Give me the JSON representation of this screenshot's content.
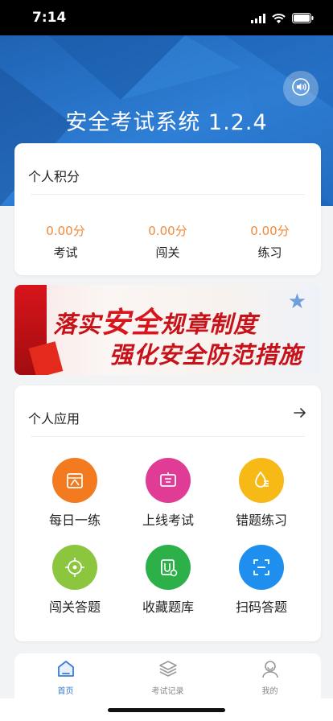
{
  "status": {
    "time": "7:14"
  },
  "header": {
    "title": "安全考试系统 1.2.4",
    "sound_icon": "speaker-icon"
  },
  "points": {
    "title": "个人积分",
    "items": [
      {
        "value": "0.00分",
        "label": "考试"
      },
      {
        "value": "0.00分",
        "label": "闯关"
      },
      {
        "value": "0.00分",
        "label": "练习"
      }
    ]
  },
  "banner": {
    "line1_a": "落实",
    "line1_b": "安全",
    "line1_c": "规章制度",
    "line2": "强化安全防范措施"
  },
  "apps": {
    "title": "个人应用",
    "items": [
      {
        "label": "每日一练",
        "icon": "calendar-icon",
        "color": "#f47a20"
      },
      {
        "label": "上线考试",
        "icon": "exam-icon",
        "color": "#e13c95"
      },
      {
        "label": "错题练习",
        "icon": "wrong-question-icon",
        "color": "#f7b916"
      },
      {
        "label": "闯关答题",
        "icon": "target-icon",
        "color": "#8cc63f"
      },
      {
        "label": "收藏题库",
        "icon": "favorite-icon",
        "color": "#2daf49"
      },
      {
        "label": "扫码答题",
        "icon": "scan-icon",
        "color": "#1e8fef"
      }
    ]
  },
  "tabbar": {
    "items": [
      {
        "label": "首页",
        "active": true
      },
      {
        "label": "考试记录",
        "active": false
      },
      {
        "label": "我的",
        "active": false
      }
    ]
  },
  "colors": {
    "accent": "#3a7bd5",
    "points_value": "#f08a3c",
    "banner_text": "#c8121a"
  }
}
